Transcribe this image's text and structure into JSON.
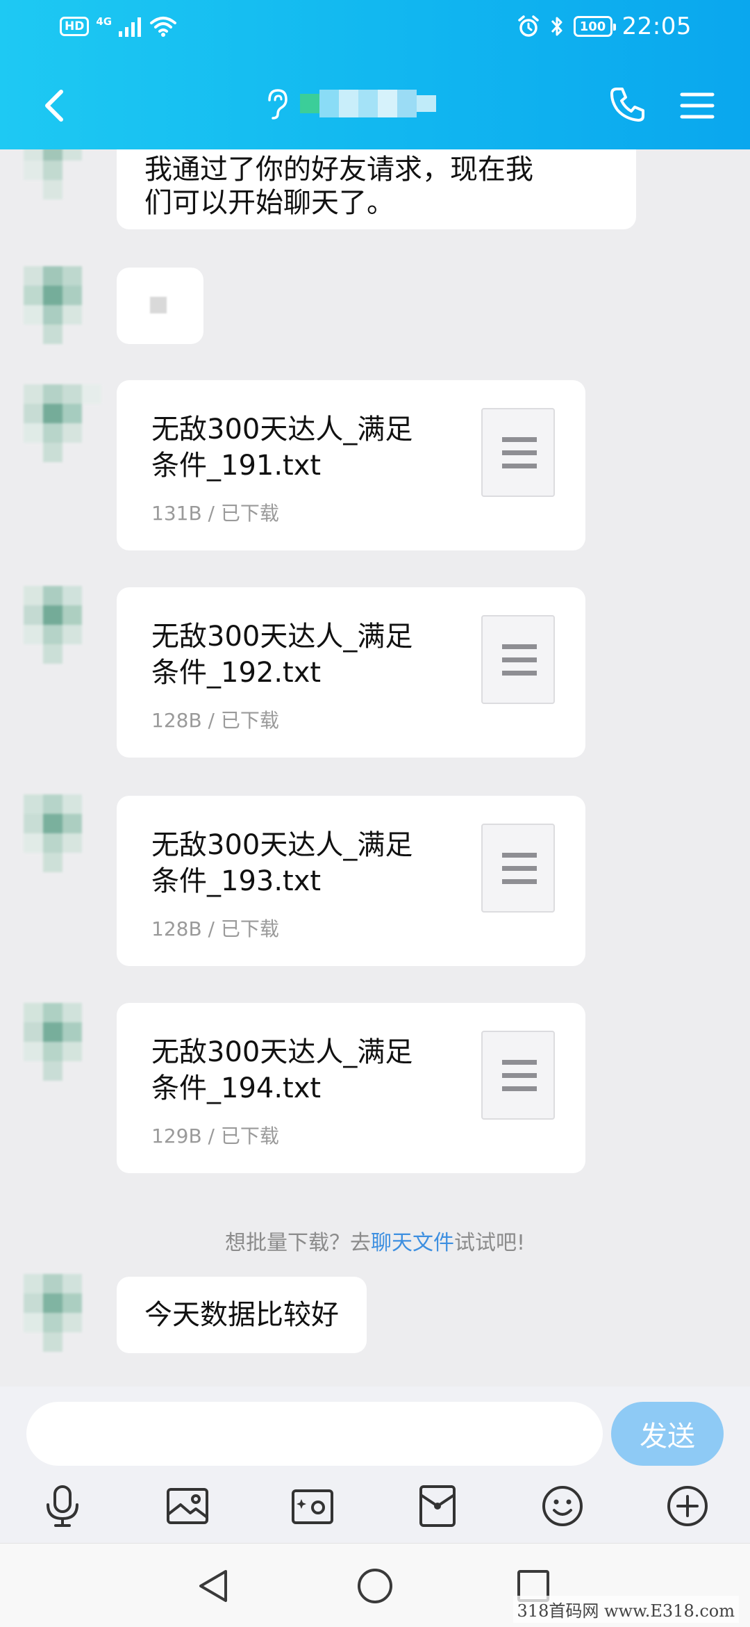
{
  "status_bar": {
    "hd_label": "HD",
    "network_label": "4G",
    "battery_level": "100",
    "time": "22:05"
  },
  "nav": {
    "contact_name_redacted": true
  },
  "messages": [
    {
      "type": "text",
      "text_line1": "我通过了你的好友请求，现在我",
      "text_line2": "们可以开始聊天了。"
    },
    {
      "type": "image_redacted"
    },
    {
      "type": "file",
      "name_line1": "无敌300天达人_满足",
      "name_line2": "条件_191.txt",
      "meta": "131B / 已下载"
    },
    {
      "type": "file",
      "name_line1": "无敌300天达人_满足",
      "name_line2": "条件_192.txt",
      "meta": "128B / 已下载"
    },
    {
      "type": "file",
      "name_line1": "无敌300天达人_满足",
      "name_line2": "条件_193.txt",
      "meta": "128B / 已下载"
    },
    {
      "type": "file",
      "name_line1": "无敌300天达人_满足",
      "name_line2": "条件_194.txt",
      "meta": "129B / 已下载"
    },
    {
      "type": "text",
      "text": "今天数据比较好"
    }
  ],
  "hint": {
    "prefix": "想批量下载？去",
    "link": "聊天文件",
    "suffix": "试试吧!"
  },
  "input": {
    "value": "",
    "send_label": "发送"
  },
  "toolbar": [
    "microphone-icon",
    "image-icon",
    "camera-icon",
    "red-packet-icon",
    "emoji-icon",
    "plus-icon"
  ],
  "watermark": "318首码网 www.E318.com",
  "colors": {
    "header_start": "#1ec9f3",
    "header_end": "#0aa7ee",
    "send_button": "#8ecaf5",
    "link": "#3d8fe0",
    "background": "#ededef"
  }
}
